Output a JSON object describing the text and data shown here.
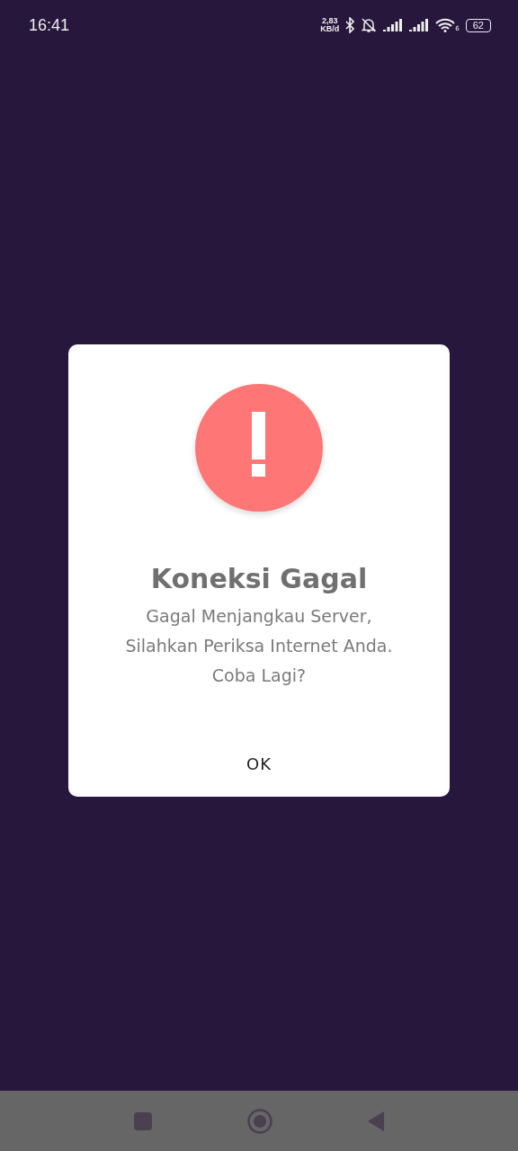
{
  "status_bar": {
    "time": "16:41",
    "speed_value": "2,83",
    "speed_unit": "KB/d",
    "wifi_badge": "6",
    "battery": "62"
  },
  "dialog": {
    "title": "Koneksi Gagal",
    "message": "Gagal Menjangkau Server, Silahkan Periksa Internet Anda. Coba Lagi?",
    "button": "OK"
  }
}
